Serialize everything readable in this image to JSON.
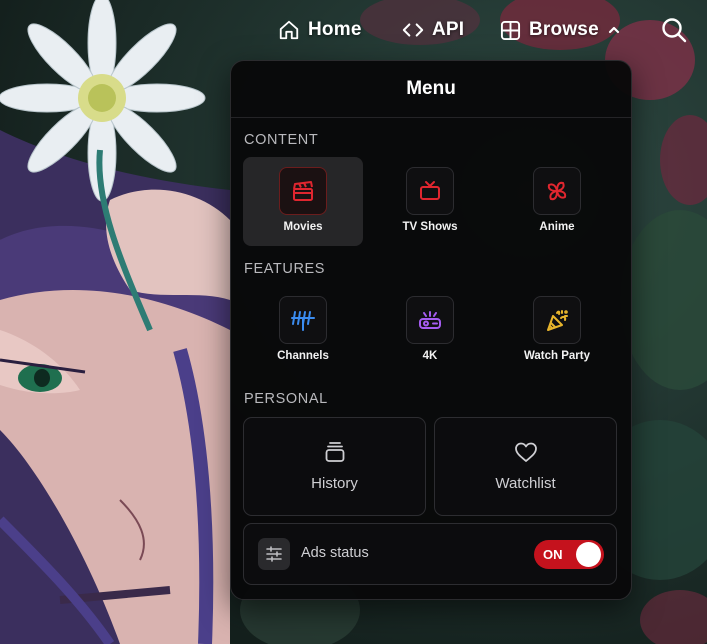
{
  "nav": {
    "home_label": "Home",
    "api_label": "API",
    "browse_label": "Browse"
  },
  "menu": {
    "title": "Menu",
    "sections": {
      "content": {
        "label": "CONTENT",
        "items": [
          {
            "label": "Movies",
            "icon": "clapperboard-icon",
            "color": "#e0262f",
            "active": true
          },
          {
            "label": "TV Shows",
            "icon": "tv-icon",
            "color": "#e0262f"
          },
          {
            "label": "Anime",
            "icon": "pinwheel-icon",
            "color": "#e0262f"
          }
        ]
      },
      "features": {
        "label": "FEATURES",
        "items": [
          {
            "label": "Channels",
            "icon": "antenna-icon",
            "color": "#3b8cf0"
          },
          {
            "label": "4K",
            "icon": "projector-icon",
            "color": "#a55cf0"
          },
          {
            "label": "Watch Party",
            "icon": "party-popper-icon",
            "color": "#e8b52c"
          }
        ]
      },
      "personal": {
        "label": "PERSONAL",
        "items": [
          {
            "label": "History",
            "icon": "history-stack-icon"
          },
          {
            "label": "Watchlist",
            "icon": "heart-icon"
          }
        ]
      }
    },
    "ads": {
      "label": "Ads status",
      "icon": "sliders-icon",
      "toggle_text": "ON",
      "enabled": true,
      "toggle_color": "#c5121d"
    }
  }
}
